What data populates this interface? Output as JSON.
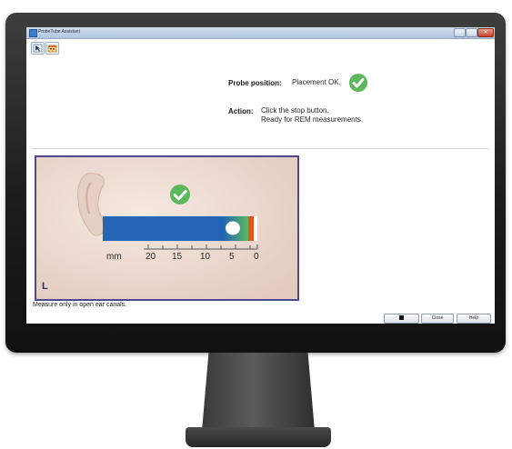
{
  "window": {
    "title": "ProbeTube Assistant",
    "toolbar_icons": [
      "pointer-icon",
      "calendar-icon"
    ]
  },
  "status": {
    "position_label": "Probe position:",
    "position_value": "Placement OK.",
    "action_label": "Action:",
    "action_line1": "Click the stop button.",
    "action_line2": "Ready for REM measurements."
  },
  "ear_image": {
    "scale_unit": "mm",
    "scale_ticks": [
      "20",
      "15",
      "10",
      "5",
      "0"
    ],
    "ear_side": "L"
  },
  "hint": "Measure only in open ear canals.",
  "buttons": {
    "close_label": "Close",
    "help_label": "Help"
  },
  "colors": {
    "ok_green": "#5cb85c",
    "probe_blue": "#2466b5",
    "target_orange": "#e5531c",
    "panel_border": "#4b4a8f"
  }
}
